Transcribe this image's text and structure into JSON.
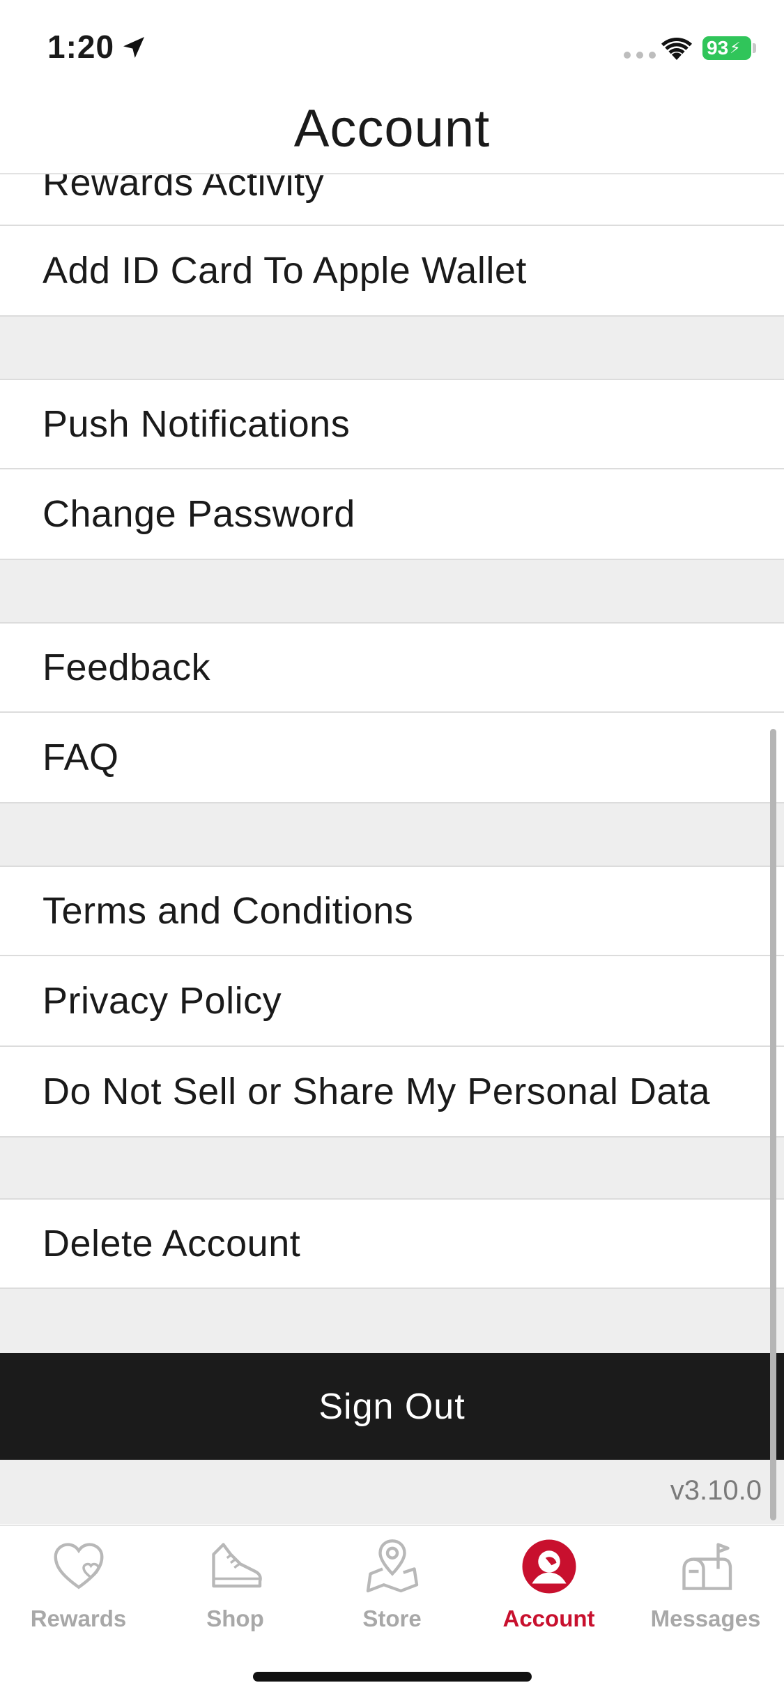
{
  "status_bar": {
    "time": "1:20",
    "battery": "93"
  },
  "header": {
    "title": "Account"
  },
  "menu": {
    "rewards_activity": "Rewards Activity",
    "add_id_card": "Add ID Card To Apple Wallet",
    "push_notifications": "Push Notifications",
    "change_password": "Change Password",
    "feedback": "Feedback",
    "faq": "FAQ",
    "terms": "Terms and Conditions",
    "privacy": "Privacy Policy",
    "do_not_sell": "Do Not Sell or Share My Personal Data",
    "delete_account": "Delete Account"
  },
  "sign_out": "Sign Out",
  "version": "v3.10.0",
  "tabs": {
    "rewards": "Rewards",
    "shop": "Shop",
    "store": "Store",
    "account": "Account",
    "messages": "Messages"
  },
  "colors": {
    "accent": "#c8102e",
    "inactive": "#a8a8a8",
    "signout_bg": "#1b1b1b",
    "section_gap": "#eeeeee"
  },
  "icons": {
    "rewards": "heart-icon",
    "shop": "sneaker-icon",
    "store": "map-pin-icon",
    "account": "account-icon",
    "messages": "mailbox-icon"
  }
}
